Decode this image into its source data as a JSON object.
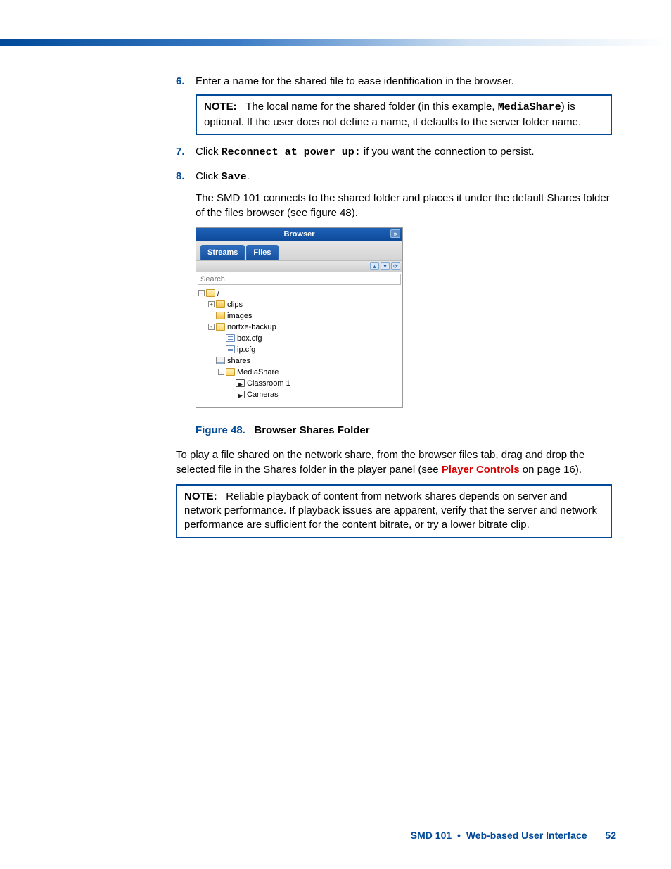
{
  "steps": {
    "s6": {
      "num": "6.",
      "text": "Enter a name for the shared file to ease identification in the browser."
    },
    "s6_note": {
      "label": "NOTE:",
      "pre": "The local name for the shared folder (in this example, ",
      "code": "MediaShare",
      "post": ") is optional. If the user does not define a name, it defaults to the server folder name."
    },
    "s7": {
      "num": "7.",
      "pre": "Click ",
      "code": "Reconnect at power up:",
      "post": " if you want the connection to persist."
    },
    "s8": {
      "num": "8.",
      "pre": "Click ",
      "code": "Save",
      "post": "."
    },
    "s8_after": "The SMD 101 connects to the shared folder and places it under the default Shares folder of the files browser (see figure 48)."
  },
  "browser": {
    "title": "Browser",
    "tab_streams": "Streams",
    "tab_files": "Files",
    "search_placeholder": "Search",
    "tree": {
      "root": "/",
      "clips": "clips",
      "images": "images",
      "nortxe": "nortxe-backup",
      "boxcfg": "box.cfg",
      "ipcfg": "ip.cfg",
      "shares": "shares",
      "mediashare": "MediaShare",
      "classroom": "Classroom 1",
      "cameras": "Cameras"
    }
  },
  "figure": {
    "num": "Figure 48.",
    "title": "Browser Shares Folder"
  },
  "after_para": {
    "pre": "To play a file shared on the network share, from the browser files tab, drag and drop the selected file in the Shares folder in the player panel (see ",
    "link": "Player Controls",
    "post": " on page 16)."
  },
  "note2": {
    "label": "NOTE:",
    "text": "Reliable playback of content from network shares depends on server and network performance. If playback issues are apparent, verify that the server and network performance are sufficient for the content bitrate, or try a lower bitrate clip."
  },
  "footer": {
    "product": "SMD 101",
    "section": "Web-based User Interface",
    "page": "52"
  }
}
